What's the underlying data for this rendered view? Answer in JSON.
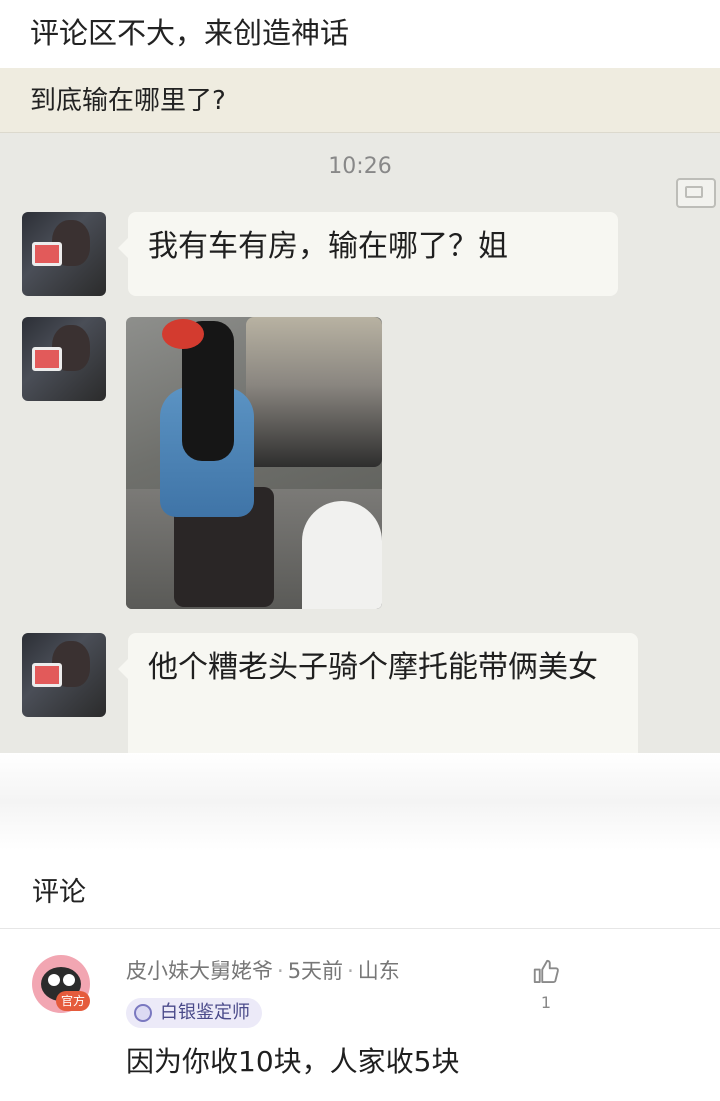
{
  "post": {
    "title": "评论区不大，来创造神话"
  },
  "screenshot": {
    "question": "到底输在哪里了?",
    "timestamp": "10:26",
    "messages": [
      {
        "text": "我有车有房，输在哪了？姐"
      },
      {
        "text": "他个糟老头子骑个摩托能带俩美女"
      }
    ]
  },
  "comments_section": {
    "heading": "评论",
    "comments": [
      {
        "user": "皮小妹大舅姥爷",
        "time": "5天前",
        "location": "山东",
        "tag": "官方",
        "badge": "白银鉴定师",
        "text": "因为你收10块，人家收5块",
        "likes": "1"
      }
    ]
  }
}
